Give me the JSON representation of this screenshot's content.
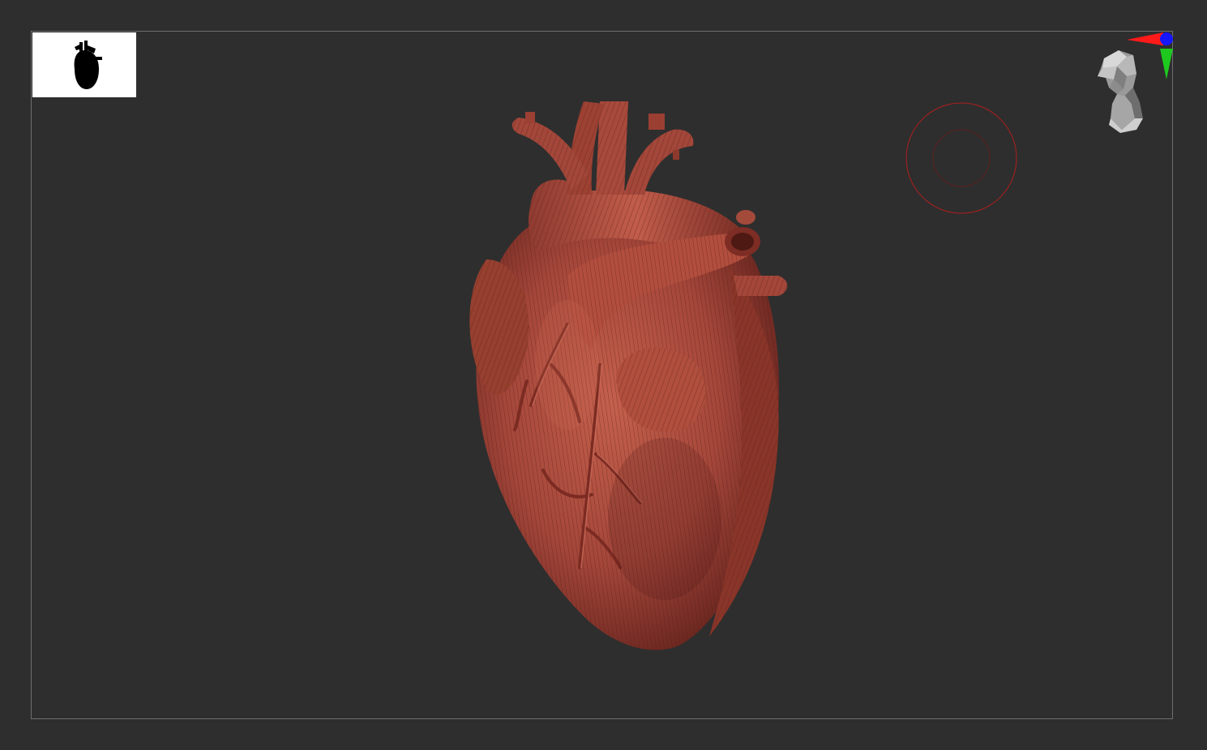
{
  "app": {
    "canvas_background": "#2e2e2e",
    "frame_color": "#6e6e6e",
    "model_color": "#a9473a",
    "model_highlight": "#c8604f",
    "model_shadow": "#5e211a"
  },
  "thumbnail": {
    "icon": "heart-silhouette-icon",
    "background": "#ffffff"
  },
  "nav_gizmo": {
    "icon": "head-orientation-icon",
    "axis_x_color": "#ff0000",
    "axis_y_color": "#00cc00",
    "axis_z_color": "#0000ff"
  },
  "brush_cursor": {
    "icon": "brush-radius-circle",
    "color": "#b01e1e"
  }
}
